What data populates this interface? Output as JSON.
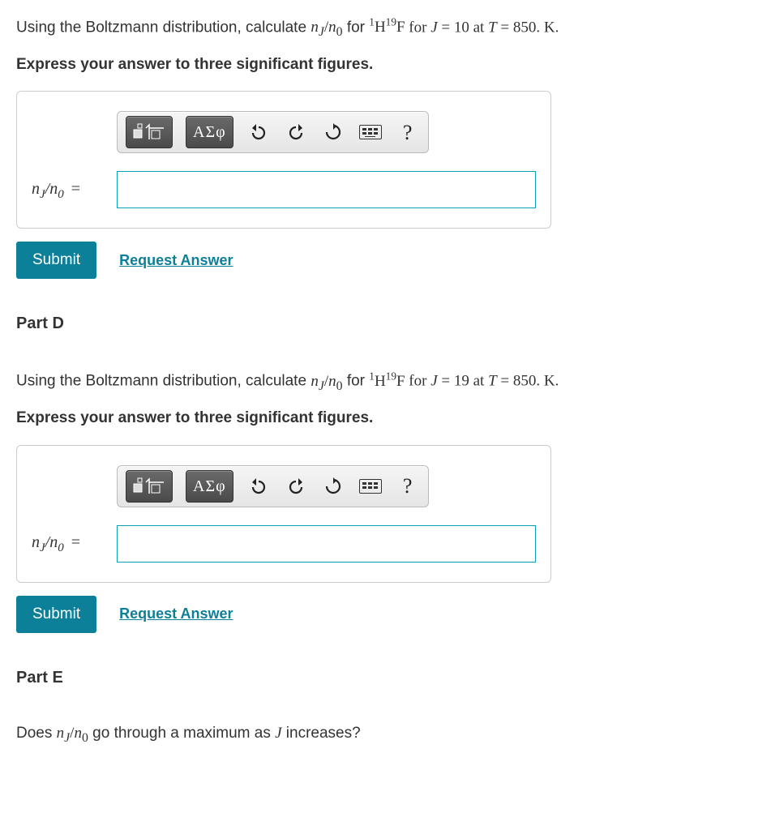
{
  "partC": {
    "question_prefix": "Using the Boltzmann distribution, calculate ",
    "ratio": "n_J / n_0",
    "for_text": " for ",
    "molecule_html": "1H19F",
    "condition": " for J = 10 at T = 850. K.",
    "instruction": "Express your answer to three significant figures.",
    "lhs": "nJ/n0 =",
    "answer_value": "",
    "submit": "Submit",
    "request": "Request Answer"
  },
  "partD": {
    "heading": "Part D",
    "question_prefix": "Using the Boltzmann distribution, calculate ",
    "condition": " for J = 19 at T = 850. K.",
    "instruction": "Express your answer to three significant figures.",
    "lhs": "nJ/n0 =",
    "answer_value": "",
    "submit": "Submit",
    "request": "Request Answer"
  },
  "partE": {
    "heading": "Part E",
    "question": "Does nJ/n0 go through a maximum as J increases?"
  },
  "toolbar": {
    "templates": "templates",
    "symbols": "ΑΣφ",
    "undo": "undo",
    "redo": "redo",
    "reset": "reset",
    "keyboard": "keyboard",
    "help": "?"
  }
}
